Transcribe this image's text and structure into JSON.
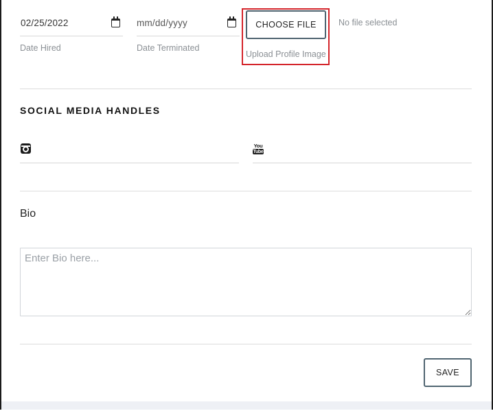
{
  "dates": {
    "hired": {
      "value": "02/25/2022",
      "label": "Date Hired"
    },
    "terminated": {
      "value": "mm/dd/yyyy",
      "label": "Date Terminated"
    }
  },
  "file_upload": {
    "button_label": "CHOOSE FILE",
    "status": "No file selected",
    "label": "Upload Profile Image",
    "highlight_color": "#d4242a"
  },
  "social": {
    "title": "SOCIAL MEDIA HANDLES",
    "instagram_icon": "instagram-icon",
    "youtube_icon": "youtube-icon",
    "youtube_icon_text": {
      "top": "You",
      "bottom": "Tube"
    }
  },
  "bio": {
    "label": "Bio",
    "placeholder": "Enter Bio here..."
  },
  "actions": {
    "save_label": "SAVE"
  }
}
